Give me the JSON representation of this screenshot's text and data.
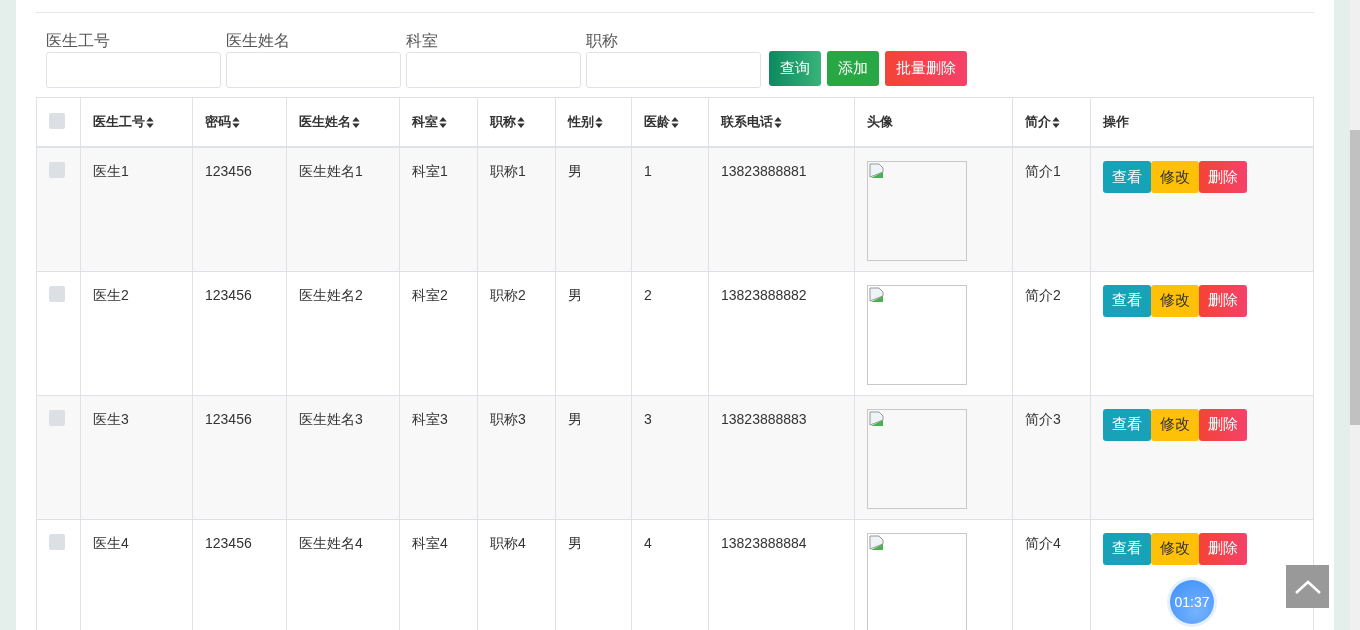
{
  "filters": [
    {
      "label": "医生工号"
    },
    {
      "label": "医生姓名"
    },
    {
      "label": "科室"
    },
    {
      "label": "职称"
    }
  ],
  "buttons": [
    {
      "kind": "search",
      "label": "查询"
    },
    {
      "kind": "add",
      "label": "添加"
    },
    {
      "kind": "delete",
      "label": "批量删除"
    }
  ],
  "table": {
    "select_all": {
      "checked": false
    },
    "columns": [
      {
        "label": "医生工号",
        "sortable": true
      },
      {
        "label": "密码",
        "sortable": true
      },
      {
        "label": "医生姓名",
        "sortable": true
      },
      {
        "label": "科室",
        "sortable": true
      },
      {
        "label": "职称",
        "sortable": true
      },
      {
        "label": "性别",
        "sortable": true
      },
      {
        "label": "医龄",
        "sortable": true
      },
      {
        "label": "联系电话",
        "sortable": true
      },
      {
        "label": "头像",
        "sortable": false
      },
      {
        "label": "简介",
        "sortable": true
      },
      {
        "label": "操作",
        "sortable": false
      }
    ],
    "rows": [
      {
        "checked": false,
        "cells": [
          "医生1",
          "123456",
          "医生姓名1",
          "科室1",
          "职称1",
          "男",
          "1",
          "13823888881"
        ],
        "intro": "简介1",
        "actions": [
          {
            "kind": "view",
            "label": "查看"
          },
          {
            "kind": "edit",
            "label": "修改"
          },
          {
            "kind": "delete",
            "label": "删除"
          }
        ]
      },
      {
        "checked": false,
        "cells": [
          "医生2",
          "123456",
          "医生姓名2",
          "科室2",
          "职称2",
          "男",
          "2",
          "13823888882"
        ],
        "intro": "简介2",
        "actions": [
          {
            "kind": "view",
            "label": "查看"
          },
          {
            "kind": "edit",
            "label": "修改"
          },
          {
            "kind": "delete",
            "label": "删除"
          }
        ]
      },
      {
        "checked": false,
        "cells": [
          "医生3",
          "123456",
          "医生姓名3",
          "科室3",
          "职称3",
          "男",
          "3",
          "13823888883"
        ],
        "intro": "简介3",
        "actions": [
          {
            "kind": "view",
            "label": "查看"
          },
          {
            "kind": "edit",
            "label": "修改"
          },
          {
            "kind": "delete",
            "label": "删除"
          }
        ]
      },
      {
        "checked": false,
        "cells": [
          "医生4",
          "123456",
          "医生姓名4",
          "科室4",
          "职称4",
          "男",
          "4",
          "13823888884"
        ],
        "intro": "简介4",
        "actions": [
          {
            "kind": "view",
            "label": "查看"
          },
          {
            "kind": "edit",
            "label": "修改"
          },
          {
            "kind": "delete",
            "label": "删除"
          }
        ]
      }
    ]
  },
  "timer": "01:37"
}
